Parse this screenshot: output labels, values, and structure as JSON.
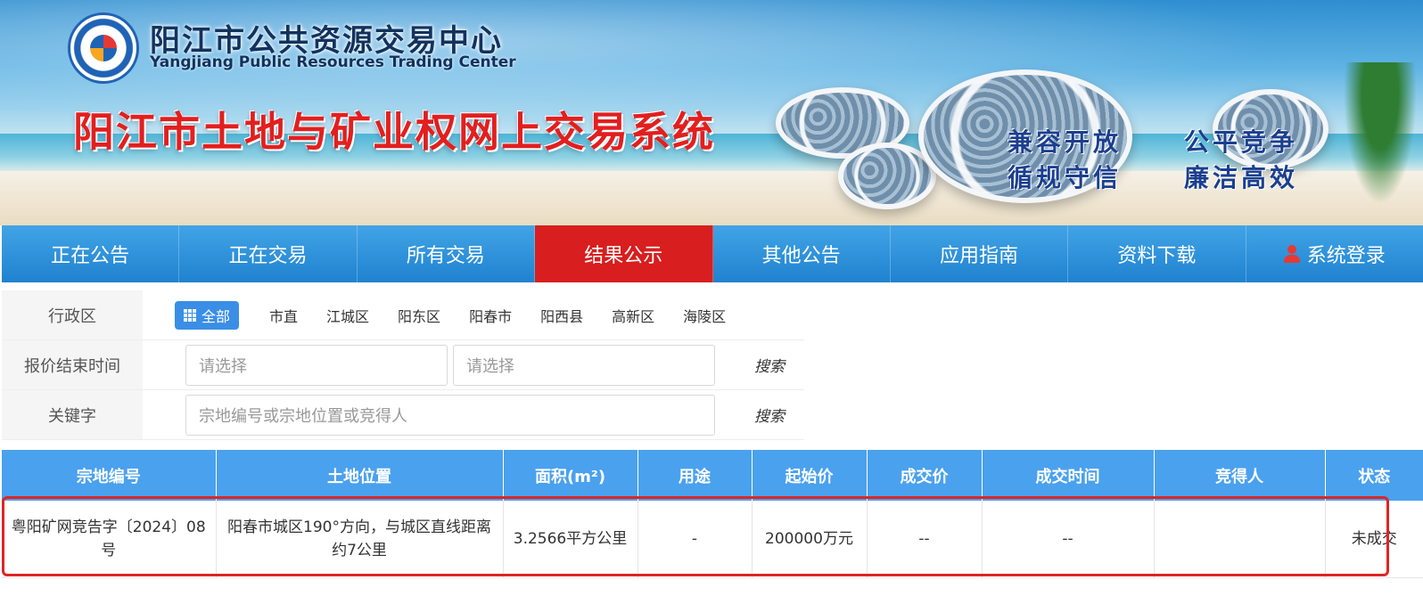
{
  "header": {
    "org_name_cn": "阳江市公共资源交易中心",
    "org_name_en": "Yangjiang Public Resources Trading Center",
    "system_title": "阳江市土地与矿业权网上交易系统",
    "slogans": [
      "兼容开放",
      "公平竞争",
      "循规守信",
      "廉洁高效"
    ]
  },
  "nav": {
    "items": [
      {
        "label": "正在公告"
      },
      {
        "label": "正在交易"
      },
      {
        "label": "所有交易"
      },
      {
        "label": "结果公示",
        "active": true
      },
      {
        "label": "其他公告"
      },
      {
        "label": "应用指南"
      },
      {
        "label": "资料下载"
      },
      {
        "label": "系统登录",
        "icon": "user-icon"
      }
    ],
    "active_color": "#d81e1e",
    "bar_color": "#2b8fd9"
  },
  "filters": {
    "region_label": "行政区",
    "region_all": "全部",
    "regions": [
      "市直",
      "江城区",
      "阳东区",
      "阳春市",
      "阳西县",
      "高新区",
      "海陵区"
    ],
    "time_label": "报价结束时间",
    "time_start_placeholder": "请选择",
    "time_end_placeholder": "请选择",
    "keyword_label": "关键字",
    "keyword_placeholder": "宗地编号或宗地位置或竞得人",
    "search_label": "搜索"
  },
  "table": {
    "columns": [
      "宗地编号",
      "土地位置",
      "面积(m²)",
      "用途",
      "起始价",
      "成交价",
      "成交时间",
      "竞得人",
      "状态"
    ],
    "rows": [
      {
        "parcel_no": "粤阳矿网竞告字〔2024〕08号",
        "location": "阳春市城区190°方向，与城区直线距离约7公里",
        "area": "3.2566平方公里",
        "use": "-",
        "start_price": "200000万元",
        "deal_price": "--",
        "deal_time": "--",
        "winner": "",
        "status": "未成交"
      }
    ],
    "header_color": "#4aa1ee",
    "highlight_color": "#e02424"
  }
}
